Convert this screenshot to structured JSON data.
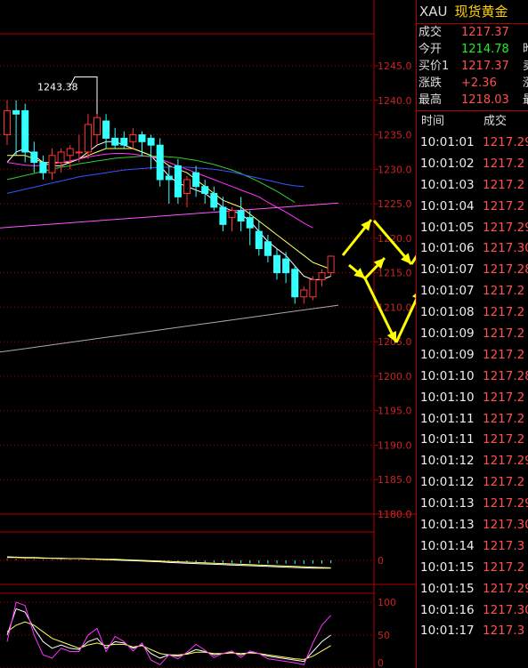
{
  "header": {
    "symbol": "XAU",
    "name": "现货黄金"
  },
  "quote": [
    {
      "label": "成交",
      "value": "1217.37",
      "color": "#ff5050",
      "extra": ""
    },
    {
      "label": "今开",
      "value": "1214.78",
      "color": "#22ee22",
      "extra": "昨"
    },
    {
      "label": "买价1",
      "value": "1217.37",
      "color": "#ff5050",
      "extra": "卖"
    },
    {
      "label": "涨跌",
      "value": "+2.36",
      "color": "#ff5050",
      "extra": "涨"
    },
    {
      "label": "最高",
      "value": "1218.03",
      "color": "#ff5050",
      "extra": "最"
    }
  ],
  "ticks_header": {
    "time": "时间",
    "price": "成交"
  },
  "ticks": [
    {
      "time": "10:01:01",
      "price": "1217.29"
    },
    {
      "time": "10:01:02",
      "price": "1217.2"
    },
    {
      "time": "10:01:03",
      "price": "1217.2"
    },
    {
      "time": "10:01:04",
      "price": "1217.2"
    },
    {
      "time": "10:01:05",
      "price": "1217.29"
    },
    {
      "time": "10:01:06",
      "price": "1217.30"
    },
    {
      "time": "10:01:07",
      "price": "1217.28"
    },
    {
      "time": "10:01:07",
      "price": "1217.2"
    },
    {
      "time": "10:01:08",
      "price": "1217.2"
    },
    {
      "time": "10:01:09",
      "price": "1217.2"
    },
    {
      "time": "10:01:09",
      "price": "1217.2"
    },
    {
      "time": "10:01:10",
      "price": "1217.28"
    },
    {
      "time": "10:01:10",
      "price": "1217.2"
    },
    {
      "time": "10:01:11",
      "price": "1217.2"
    },
    {
      "time": "10:01:11",
      "price": "1217.2"
    },
    {
      "time": "10:01:12",
      "price": "1217.29"
    },
    {
      "time": "10:01:12",
      "price": "1217.2"
    },
    {
      "time": "10:01:13",
      "price": "1217.29"
    },
    {
      "time": "10:01:13",
      "price": "1217.30"
    },
    {
      "time": "10:01:14",
      "price": "1217.3"
    },
    {
      "time": "10:01:15",
      "price": "1217.2"
    },
    {
      "time": "10:01:15",
      "price": "1217.29"
    },
    {
      "time": "10:01:16",
      "price": "1217.30"
    },
    {
      "time": "10:01:17",
      "price": "1217.3"
    }
  ],
  "colors": {
    "up": "#ff3333",
    "down": "#33ffff",
    "grid": "#b00000",
    "axis_text": "#cc2222",
    "arrow": "#ffff00"
  },
  "chart_data": {
    "type": "candlestick",
    "ylim": [
      1180,
      1245
    ],
    "y_ticks": [
      "1245.0",
      "1240.0",
      "1235.0",
      "1230.0",
      "1225.0",
      "1220.0",
      "1215.0",
      "1210.0",
      "1205.0",
      "1200.0",
      "1195.0",
      "1190.0",
      "1185.0",
      "1180.0"
    ],
    "max_label": "1243.38",
    "max_value": 1243.38,
    "candles": [
      {
        "o": 1235.0,
        "h": 1240.0,
        "l": 1233.5,
        "c": 1238.5
      },
      {
        "o": 1238.5,
        "h": 1240.0,
        "l": 1232.0,
        "c": 1238.0
      },
      {
        "o": 1238.5,
        "h": 1239.5,
        "l": 1231.0,
        "c": 1232.5
      },
      {
        "o": 1232.5,
        "h": 1234.0,
        "l": 1229.5,
        "c": 1231.0
      },
      {
        "o": 1231.0,
        "h": 1232.0,
        "l": 1228.5,
        "c": 1229.5
      },
      {
        "o": 1229.5,
        "h": 1233.0,
        "l": 1228.5,
        "c": 1232.0
      },
      {
        "o": 1231.0,
        "h": 1233.0,
        "l": 1229.5,
        "c": 1232.5
      },
      {
        "o": 1232.0,
        "h": 1233.5,
        "l": 1230.0,
        "c": 1233.0
      },
      {
        "o": 1232.5,
        "h": 1235.0,
        "l": 1231.0,
        "c": 1232.5
      },
      {
        "o": 1232.5,
        "h": 1238.0,
        "l": 1231.5,
        "c": 1236.5
      },
      {
        "o": 1235.0,
        "h": 1243.4,
        "l": 1233.5,
        "c": 1237.5
      },
      {
        "o": 1237.0,
        "h": 1238.0,
        "l": 1233.0,
        "c": 1234.5
      },
      {
        "o": 1234.5,
        "h": 1236.0,
        "l": 1233.0,
        "c": 1233.5
      },
      {
        "o": 1234.5,
        "h": 1235.5,
        "l": 1233.0,
        "c": 1233.5
      },
      {
        "o": 1234.0,
        "h": 1236.0,
        "l": 1233.0,
        "c": 1235.0
      },
      {
        "o": 1235.0,
        "h": 1235.5,
        "l": 1232.0,
        "c": 1234.0
      },
      {
        "o": 1234.5,
        "h": 1235.0,
        "l": 1230.0,
        "c": 1233.5
      },
      {
        "o": 1233.5,
        "h": 1234.5,
        "l": 1227.5,
        "c": 1228.5
      },
      {
        "o": 1229.0,
        "h": 1230.5,
        "l": 1225.0,
        "c": 1228.5
      },
      {
        "o": 1230.5,
        "h": 1231.5,
        "l": 1225.0,
        "c": 1226.0
      },
      {
        "o": 1226.5,
        "h": 1229.0,
        "l": 1224.5,
        "c": 1228.5
      },
      {
        "o": 1229.5,
        "h": 1230.5,
        "l": 1226.0,
        "c": 1227.5
      },
      {
        "o": 1227.5,
        "h": 1228.5,
        "l": 1225.0,
        "c": 1226.5
      },
      {
        "o": 1226.5,
        "h": 1227.5,
        "l": 1224.0,
        "c": 1224.5
      },
      {
        "o": 1224.5,
        "h": 1226.0,
        "l": 1221.0,
        "c": 1222.0
      },
      {
        "o": 1223.0,
        "h": 1224.5,
        "l": 1221.0,
        "c": 1224.0
      },
      {
        "o": 1224.0,
        "h": 1226.0,
        "l": 1221.0,
        "c": 1222.5
      },
      {
        "o": 1223.0,
        "h": 1224.0,
        "l": 1219.0,
        "c": 1221.5
      },
      {
        "o": 1221.0,
        "h": 1222.5,
        "l": 1217.5,
        "c": 1218.5
      },
      {
        "o": 1219.5,
        "h": 1220.5,
        "l": 1216.5,
        "c": 1217.5
      },
      {
        "o": 1217.5,
        "h": 1218.5,
        "l": 1214.0,
        "c": 1215.0
      },
      {
        "o": 1217.0,
        "h": 1218.0,
        "l": 1213.5,
        "c": 1215.0
      },
      {
        "o": 1215.5,
        "h": 1216.0,
        "l": 1210.5,
        "c": 1211.5
      },
      {
        "o": 1211.5,
        "h": 1213.0,
        "l": 1210.5,
        "c": 1212.5
      },
      {
        "o": 1211.5,
        "h": 1214.5,
        "l": 1211.0,
        "c": 1214.0
      },
      {
        "o": 1214.0,
        "h": 1215.5,
        "l": 1213.0,
        "c": 1215.0
      },
      {
        "o": 1215.0,
        "h": 1217.5,
        "l": 1214.5,
        "c": 1217.4
      }
    ],
    "series": [
      {
        "color": "#ffffff",
        "values": [
          1231.0,
          1232.5,
          1233.0,
          1232.0,
          1231.0,
          1230.5,
          1230.5,
          1231.0,
          1231.5,
          1232.5,
          1233.5,
          1234.0,
          1234.0,
          1233.5,
          1233.0,
          1232.5,
          1232.0,
          1230.5,
          1229.0,
          1228.0,
          1227.5,
          1227.0,
          1226.5,
          1225.5,
          1224.5,
          1224.0,
          1223.5,
          1222.5,
          1221.0,
          1219.5,
          1218.5,
          1217.5,
          1216.0,
          1214.5,
          1214.0,
          1214.0,
          1214.5
        ]
      },
      {
        "color": "#ffff66",
        "values": [
          1232.0,
          1232.0,
          1232.0,
          1231.5,
          1231.0,
          1231.0,
          1231.0,
          1231.0,
          1231.5,
          1232.0,
          1232.5,
          1233.0,
          1233.0,
          1233.0,
          1233.0,
          1232.5,
          1232.0,
          1231.5,
          1230.5,
          1230.0,
          1229.5,
          1228.5,
          1227.5,
          1226.5,
          1225.5,
          1225.0,
          1224.5,
          1223.5,
          1222.5,
          1221.5,
          1220.5,
          1219.5,
          1218.5,
          1217.5,
          1216.5,
          1216.0,
          1215.5
        ]
      },
      {
        "color": "#ff33ff",
        "values": [
          1231.0,
          1230.8,
          1230.6,
          1230.5,
          1230.6,
          1230.8,
          1231.0,
          1231.2,
          1231.5,
          1231.8,
          1232.0,
          1232.2,
          1232.3,
          1232.3,
          1232.2,
          1232.0,
          1231.8,
          1231.5,
          1231.0,
          1230.5,
          1230.0,
          1229.5,
          1229.0,
          1228.5,
          1228.0,
          1227.5,
          1227.0,
          1226.5,
          1226.0,
          1225.2,
          1224.5,
          1223.8,
          1223.0,
          1222.2,
          1221.5
        ]
      },
      {
        "color": "#33cc33",
        "values": [
          1228.5,
          1228.8,
          1229.1,
          1229.4,
          1229.7,
          1230.0,
          1230.3,
          1230.5,
          1230.8,
          1231.0,
          1231.2,
          1231.4,
          1231.6,
          1231.7,
          1231.8,
          1231.9,
          1231.9,
          1231.9,
          1231.8,
          1231.7,
          1231.5,
          1231.3,
          1231.0,
          1230.7,
          1230.3,
          1229.9,
          1229.4,
          1228.8,
          1228.2,
          1227.5,
          1226.8,
          1226.0,
          1225.2
        ]
      },
      {
        "color": "#3355ff",
        "values": [
          1226.5,
          1226.8,
          1227.1,
          1227.4,
          1227.7,
          1228.0,
          1228.3,
          1228.6,
          1228.9,
          1229.1,
          1229.3,
          1229.5,
          1229.7,
          1229.9,
          1230.0,
          1230.1,
          1230.2,
          1230.3,
          1230.3,
          1230.3,
          1230.3,
          1230.2,
          1230.1,
          1230.0,
          1229.8,
          1229.6,
          1229.3,
          1229.0,
          1228.7,
          1228.4,
          1228.1,
          1227.8,
          1227.6,
          1227.5
        ]
      },
      {
        "color": "#ff55ff",
        "values": [
          1221.5,
          1221.8,
          1222.1,
          1222.4,
          1222.7,
          1223.0,
          1223.3,
          1223.6,
          1223.9,
          1224.2,
          1224.5,
          1224.8,
          1225.1
        ]
      },
      {
        "color": "#aaaaaa",
        "values": [
          1203.5,
          1203.9,
          1204.3,
          1204.7,
          1205.1,
          1205.5,
          1205.9,
          1206.3,
          1206.7,
          1207.1,
          1207.5,
          1207.9,
          1208.3,
          1208.7,
          1209.1,
          1209.5,
          1209.9,
          1210.3
        ]
      }
    ],
    "macd": {
      "zero_label": "0",
      "hist": [
        0.5,
        0.5,
        0.4,
        0.4,
        0.3,
        0.3,
        0.3,
        0.3,
        0.3,
        0.3,
        0.3,
        0.2,
        0.2,
        0.1,
        0.0,
        -0.1,
        -0.2,
        -0.3,
        -0.4,
        -0.5,
        -0.5,
        -0.6,
        -0.6,
        -0.6,
        -0.7,
        -0.7,
        -0.8,
        -0.8,
        -0.8,
        -0.9,
        -0.9,
        -0.9,
        -1.0,
        -1.0,
        -0.9,
        -0.9,
        -0.8
      ],
      "line1": [
        1.0,
        0.9,
        0.8,
        0.8,
        0.7,
        0.6,
        0.6,
        0.5,
        0.5,
        0.4,
        0.3,
        0.2,
        0.1,
        0.0,
        -0.1,
        -0.2,
        -0.3,
        -0.4,
        -0.6,
        -0.7,
        -0.8,
        -0.9,
        -1.0,
        -1.1,
        -1.2,
        -1.3,
        -1.4,
        -1.5,
        -1.6,
        -1.7,
        -1.8,
        -1.9,
        -2.0,
        -2.1,
        -2.2,
        -2.2,
        -2.2
      ],
      "line2": [
        0.8,
        0.8,
        0.7,
        0.7,
        0.6,
        0.6,
        0.5,
        0.5,
        0.5,
        0.4,
        0.4,
        0.3,
        0.3,
        0.2,
        0.1,
        0.0,
        -0.1,
        -0.2,
        -0.3,
        -0.4,
        -0.5,
        -0.6,
        -0.7,
        -0.8,
        -0.9,
        -1.0,
        -1.1,
        -1.2,
        -1.3,
        -1.4,
        -1.5,
        -1.6,
        -1.7,
        -1.8,
        -1.9,
        -2.0,
        -2.1
      ]
    },
    "kdj": {
      "ticks": [
        "100",
        "50",
        "0"
      ],
      "k": [
        50,
        90,
        85,
        60,
        40,
        30,
        35,
        30,
        28,
        40,
        45,
        30,
        40,
        38,
        30,
        35,
        22,
        15,
        20,
        18,
        22,
        28,
        25,
        20,
        22,
        24,
        20,
        24,
        22,
        18,
        16,
        14,
        12,
        10,
        25,
        40,
        50
      ],
      "d": [
        55,
        65,
        70,
        65,
        55,
        45,
        40,
        35,
        30,
        35,
        38,
        34,
        36,
        36,
        32,
        34,
        28,
        22,
        20,
        20,
        21,
        24,
        24,
        22,
        22,
        23,
        22,
        23,
        22,
        20,
        18,
        16,
        14,
        13,
        18,
        26,
        34
      ],
      "j": [
        40,
        100,
        95,
        50,
        20,
        15,
        30,
        25,
        25,
        50,
        60,
        25,
        48,
        40,
        26,
        38,
        12,
        5,
        20,
        14,
        24,
        36,
        27,
        16,
        22,
        26,
        16,
        26,
        22,
        14,
        12,
        10,
        8,
        5,
        38,
        65,
        80
      ]
    },
    "annotations": [
      "arrow up to 1225 at x≈415",
      "zigzag arrows between 1225 and 1205 toward x≈470"
    ]
  }
}
